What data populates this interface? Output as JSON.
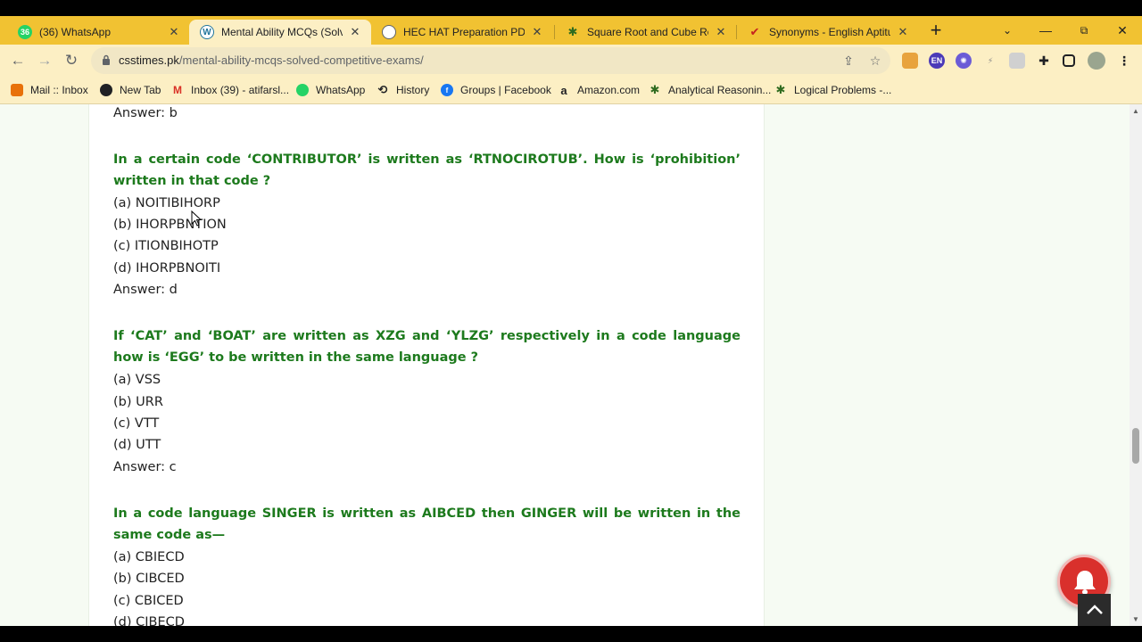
{
  "tabs": [
    {
      "title": "(36) WhatsApp",
      "badge": "36",
      "active": false
    },
    {
      "title": "Mental Ability MCQs (Solved",
      "active": true
    },
    {
      "title": "HEC HAT Preparation PDF.pd",
      "active": false
    },
    {
      "title": "Square Root and Cube Root",
      "active": false
    },
    {
      "title": "Synonyms - English Aptitude",
      "active": false
    }
  ],
  "address": {
    "domain": "csstimes.pk",
    "path": "/mental-ability-mcqs-solved-competitive-exams/"
  },
  "extension_badge": "EN",
  "bookmarks": [
    {
      "label": "Mail :: Inbox"
    },
    {
      "label": "New Tab"
    },
    {
      "label": "Inbox (39) - atifarsl..."
    },
    {
      "label": "WhatsApp"
    },
    {
      "label": "History"
    },
    {
      "label": "Groups | Facebook"
    },
    {
      "label": "Amazon.com"
    },
    {
      "label": "Analytical Reasonin..."
    },
    {
      "label": "Logical Problems -..."
    }
  ],
  "article": {
    "prev_answer": "Answer: b",
    "questions": [
      {
        "question": "In a certain code ‘CONTRIBUTOR’ is written as ‘RTNOCIROTUB’. How is ‘prohibition’ written in that code ?",
        "options": [
          "(a) NOITIBIHORP",
          "(b) IHORPBNTION",
          "(c) ITIONBIHOTP",
          "(d) IHORPBNOITI"
        ],
        "answer": "Answer: d"
      },
      {
        "question": "If ‘CAT’ and ‘BOAT’ are written as XZG and ‘YLZG’ respectively in a code language how is ‘EGG’ to be written in the same language ?",
        "options": [
          "(a) VSS",
          "(b) URR",
          "(c) VTT",
          "(d) UTT"
        ],
        "answer": "Answer: c"
      },
      {
        "question": "In a code language SINGER is written as AIBCED then GINGER will be written in the same code as—",
        "options": [
          "(a) CBIECD",
          "(b) CIBCED",
          "(c) CBICED",
          "(d) CIBECD"
        ]
      }
    ]
  }
}
